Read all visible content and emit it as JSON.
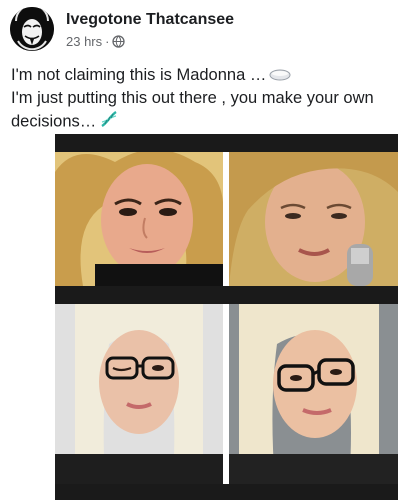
{
  "post": {
    "author": "Ivegotone Thatcansee",
    "time": "23 hrs",
    "separator": "·",
    "privacy_icon": "globe-icon",
    "line1": "I'm not claiming this is Madonna …",
    "line2": "I'm just putting this out there , you make your own decisions…",
    "line1_emoji": "pill-icon",
    "line2_emoji": "dna-icon"
  },
  "photos": [
    {
      "name": "photo-top-left",
      "subject": "blonde curls, dark eyes, black top"
    },
    {
      "name": "photo-top-right",
      "subject": "blonde curls, holding microphone"
    },
    {
      "name": "photo-bottom-left",
      "subject": "platinum hair, winking, black glasses"
    },
    {
      "name": "photo-bottom-right",
      "subject": "platinum hair, black glasses"
    }
  ],
  "colors": {
    "author": "#1c1e21",
    "meta": "#65676b",
    "text": "#1c1e21",
    "grid_bg": "#1a1a1a"
  }
}
